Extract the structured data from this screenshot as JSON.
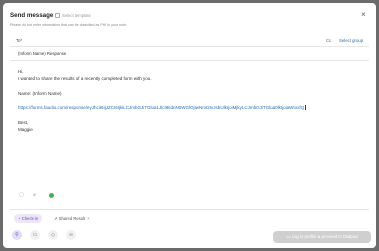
{
  "header": {
    "title": "Send message",
    "template_label": "Select template",
    "note": "Please do not enter information that can be classified as PHI in your note."
  },
  "recipients": {
    "to_label": "To*",
    "cc_label": "Cc",
    "group_label": "Select group"
  },
  "subject": "(Inform Name) Response",
  "message": {
    "greeting": "Hi,",
    "line1": "I wanted to share the results of a recently completed form with you.",
    "name_line": "Name: (Inform Name)",
    "link": "https://forms.faudio.com/response/eyJhciI6IjJZCI6IjkiLCJmbGJiTGlua1JlcI8iIdnN0WGlOjIwNmI2IvJsbUlkIjoiMjkyLCJmbGJiTGlua0lkIjoiaWIoxfQ",
    "signoff": "Best,",
    "signature": "Maggie"
  },
  "toolbar": {
    "icons": [
      "image-icon",
      "attachment-icon",
      "emoji-icon"
    ]
  },
  "chips": {
    "checkin": "Check-in",
    "shared": "Shared Result",
    "shared_remove": "×"
  },
  "bottom_icons": [
    "pin-icon",
    "inbox-icon",
    "tag-icon",
    "link-icon"
  ],
  "send_button": "Log in profile & proceed to Dialpad",
  "colors": {
    "link": "#2b6cb0",
    "checkin_chip": "#ece6f7",
    "status_dot": "#4caf50",
    "send_disabled": "#cfcfcf"
  }
}
